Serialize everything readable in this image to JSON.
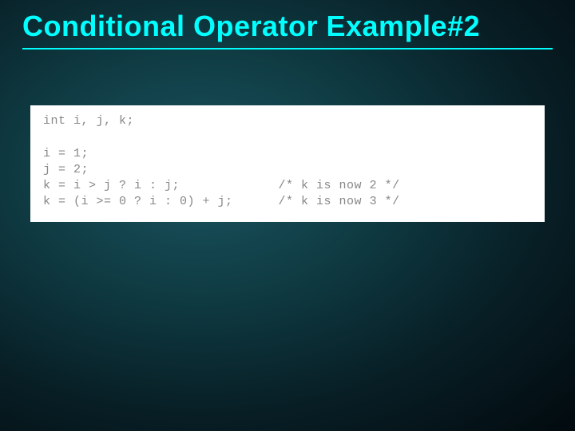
{
  "slide": {
    "title": "Conditional Operator Example#2"
  },
  "code": {
    "line1": "int i, j, k;",
    "blank1": "",
    "line2": "i = 1;",
    "line3": "j = 2;",
    "line4": "k = i > j ? i : j;             /* k is now 2 */",
    "line5": "k = (i >= 0 ? i : 0) + j;      /* k is now 3 */"
  }
}
